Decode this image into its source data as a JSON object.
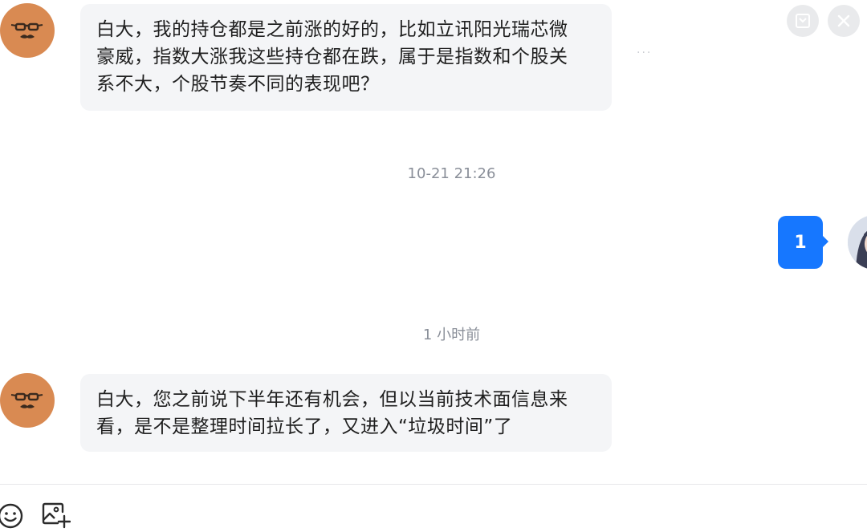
{
  "messages": [
    {
      "sender": "other",
      "text": "白大，我的持仓都是之前涨的好的，比如立讯阳光瑞芯微\n豪威，指数大涨我这些持仓都在跌，属于是指数和个股关\n系不大，个股节奏不同的表现吧？"
    },
    {
      "sender": "me",
      "text": "1"
    },
    {
      "sender": "other",
      "text": "白大，您之前说下半年还有机会，但以当前技术面信息来\n看，是不是整理时间拉长了，又进入“垃圾时间”了"
    }
  ],
  "timestamps": [
    "10-21 21:26",
    "1 小时前"
  ],
  "more_indicator": "···",
  "colors": {
    "my_bubble": "#1677ff",
    "other_bubble": "#f4f5f7",
    "timestamp": "#8a8f99",
    "avatar_other": "#d98a52"
  },
  "icons": {
    "top_right": [
      "collapse-icon",
      "close-icon"
    ],
    "input_toolbar": [
      "emoji-icon",
      "image-icon"
    ]
  }
}
